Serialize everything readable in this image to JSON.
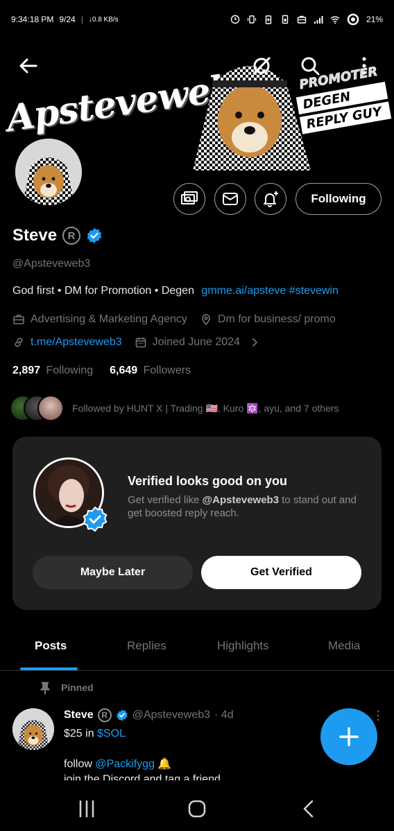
{
  "status_bar": {
    "time": "9:34:18 PM",
    "date": "9/24",
    "speed": "↓0.8 KB/s",
    "battery": "21%"
  },
  "banner": {
    "brand_text": "Apsteveweb3",
    "tags": [
      "PROMOTER",
      "DEGEN",
      "REPLY GUY"
    ]
  },
  "profile": {
    "name": "Steve",
    "reg_symbol": "R",
    "handle": "@Apsteveweb3",
    "bio_text": "God first • DM for Promotion • Degen",
    "bio_link": "gmme.ai/apsteve",
    "bio_hashtag": "#stevewin",
    "category": "Advertising & Marketing Agency",
    "location": "Dm for business/ promo",
    "website": "t.me/Apsteveweb3",
    "joined": "Joined June 2024",
    "following_count": "2,897",
    "following_label": "Following",
    "followers_count": "6,649",
    "followers_label": "Followers",
    "followed_by": "Followed by HUNT X | Trading 🇺🇸, Kuro 🔯, ayu, and 7 others",
    "follow_button": "Following"
  },
  "verify_card": {
    "title": "Verified looks good on you",
    "sub_prefix": "Get verified like",
    "sub_handle": "@Apsteveweb3",
    "sub_suffix": "to stand out and get boosted reply reach.",
    "later_label": "Maybe Later",
    "get_label": "Get Verified"
  },
  "tabs": [
    {
      "label": "Posts"
    },
    {
      "label": "Replies"
    },
    {
      "label": "Highlights"
    },
    {
      "label": "Media"
    }
  ],
  "post": {
    "pinned_label": "Pinned",
    "name": "Steve",
    "handle": "@Apsteveweb3",
    "time": "· 4d",
    "line1_text": "$25 in",
    "line1_cashtag": "$SOL",
    "line2_text": "follow",
    "line2_mention": "@Packifygg",
    "line2_emoji": "🔔",
    "line3_text": "join the Discord and tag a friend"
  },
  "colors": {
    "accent": "#1d9bf0",
    "background": "#000000",
    "card": "#1f1f1f",
    "muted": "#71767b"
  }
}
